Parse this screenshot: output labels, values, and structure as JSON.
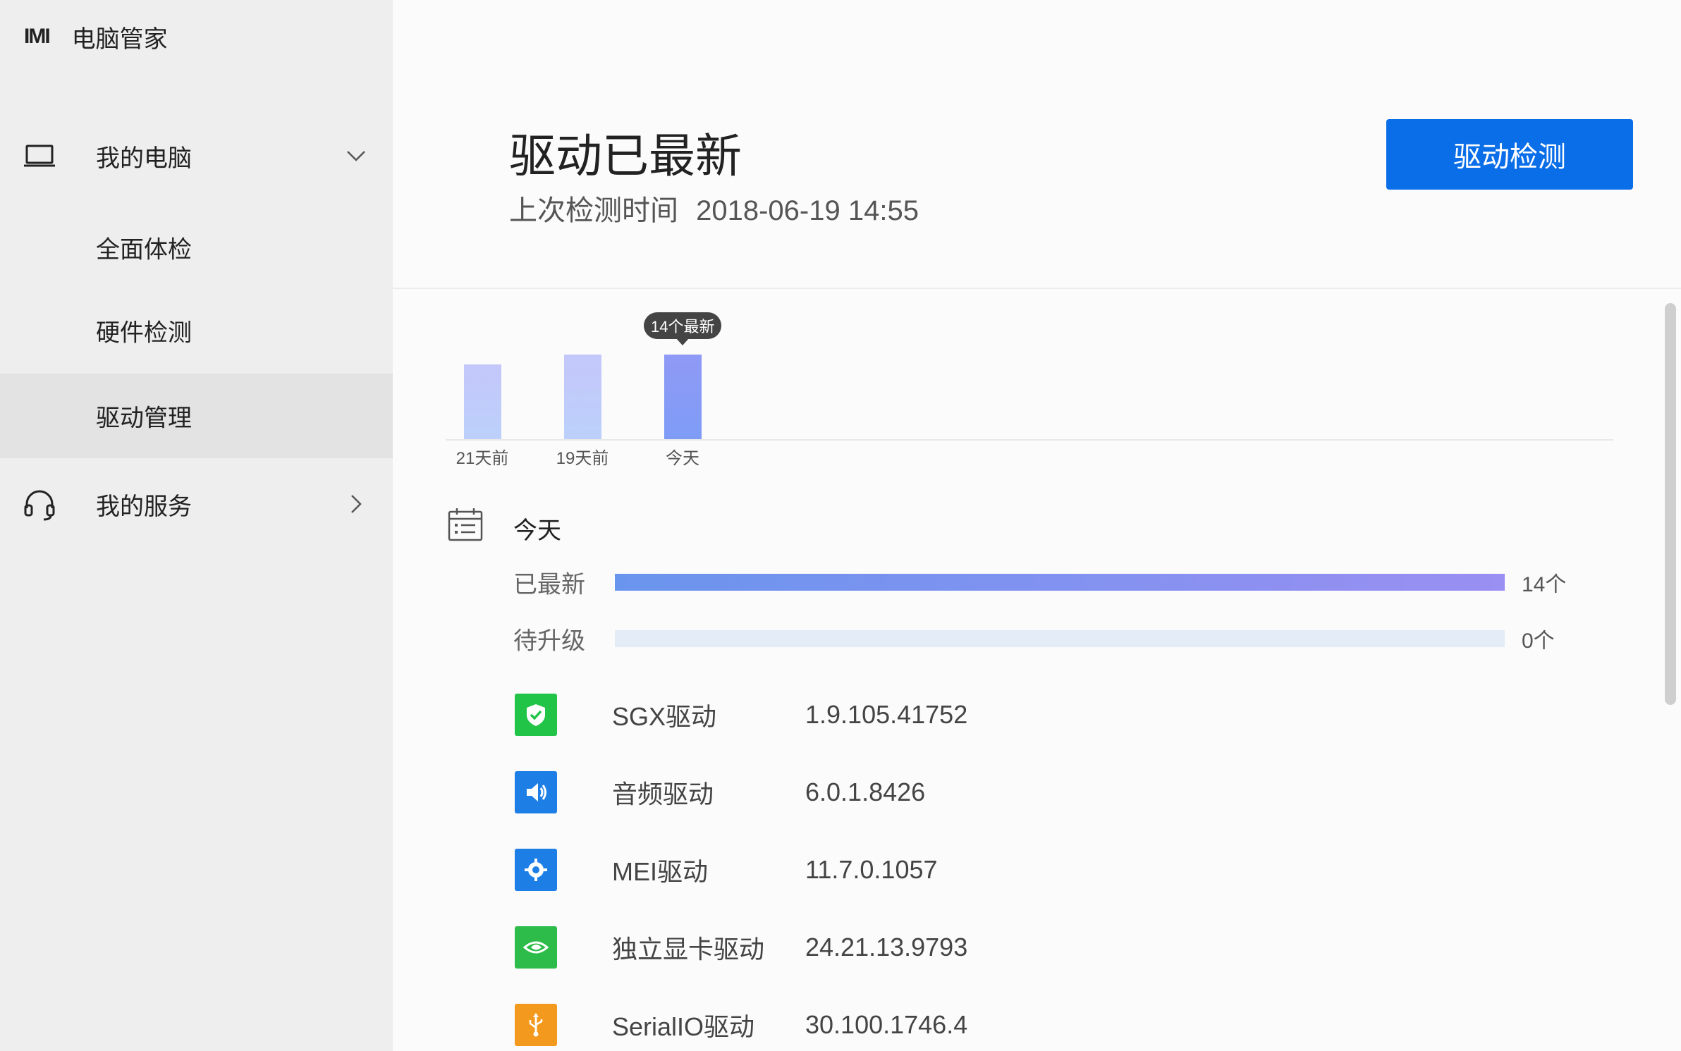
{
  "app": {
    "logo_text": "IMI",
    "name": "电脑管家"
  },
  "sidebar": {
    "my_pc": {
      "label": "我的电脑",
      "icon": "laptop-icon"
    },
    "sub_items": [
      {
        "label": "全面体检",
        "active": false
      },
      {
        "label": "硬件检测",
        "active": false
      },
      {
        "label": "驱动管理",
        "active": true
      }
    ],
    "my_service": {
      "label": "我的服务",
      "icon": "headset-icon"
    }
  },
  "header": {
    "status_title": "驱动已最新",
    "last_check_label": "上次检测时间",
    "last_check_time": "2018-06-19 14:55",
    "detect_button": "驱动检测"
  },
  "chart_data": {
    "type": "bar",
    "categories": [
      "21天前",
      "19天前",
      "今天"
    ],
    "values": [
      14,
      14,
      14
    ],
    "tooltip": "14个最新",
    "highlight_index": 2
  },
  "today": {
    "label": "今天",
    "rows": [
      {
        "label": "已最新",
        "count": "14个",
        "fraction": 1.0
      },
      {
        "label": "待升级",
        "count": "0个",
        "fraction": 0.0
      }
    ]
  },
  "drivers": [
    {
      "name": "SGX驱动",
      "version": "1.9.105.41752",
      "icon": "shield-check-icon",
      "color": "#22c447"
    },
    {
      "name": "音频驱动",
      "version": "6.0.1.8426",
      "icon": "speaker-icon",
      "color": "#1d7fe5"
    },
    {
      "name": "MEI驱动",
      "version": "11.7.0.1057",
      "icon": "chip-icon",
      "color": "#1d7fe5"
    },
    {
      "name": "独立显卡驱动",
      "version": "24.21.13.9793",
      "icon": "nvidia-eye-icon",
      "color": "#2dbc4a"
    },
    {
      "name": "SerialIO驱动",
      "version": "30.100.1746.4",
      "icon": "usb-icon",
      "color": "#f39a1e"
    }
  ],
  "colors": {
    "accent": "#0a6ee8",
    "sidebar_bg": "#eeeeee",
    "bar_light": "#c4c7fa",
    "bar_highlight": "#8f9af5"
  }
}
